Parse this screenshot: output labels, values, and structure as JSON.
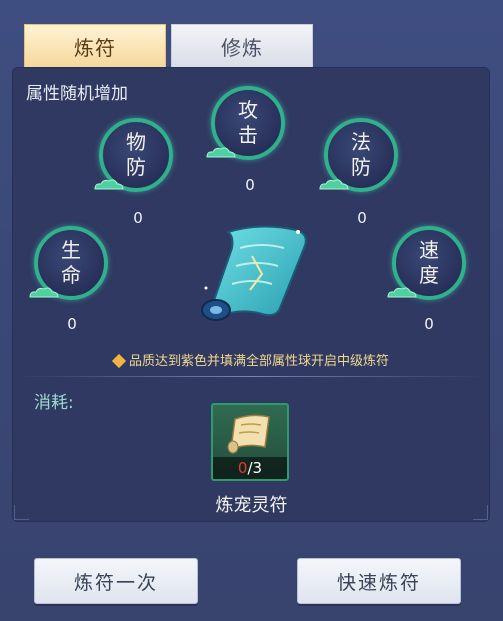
{
  "tabs": [
    {
      "label": "炼符",
      "active": true
    },
    {
      "label": "修炼",
      "active": false
    }
  ],
  "panel_title": "属性随机增加",
  "attributes": {
    "attack": {
      "label_1": "攻",
      "label_2": "击",
      "value": "0"
    },
    "phys_def": {
      "label_1": "物",
      "label_2": "防",
      "value": "0"
    },
    "magic_def": {
      "label_1": "法",
      "label_2": "防",
      "value": "0"
    },
    "hp": {
      "label_1": "生",
      "label_2": "命",
      "value": "0"
    },
    "speed": {
      "label_1": "速",
      "label_2": "度",
      "value": "0"
    }
  },
  "hint": "品质达到紫色并填满全部属性球开启中级炼符",
  "consume_label": "消耗:",
  "item": {
    "have": "0",
    "need": "/3",
    "name": "炼宠灵符"
  },
  "buttons": {
    "refine_once": "炼符一次",
    "quick_refine": "快速炼符"
  },
  "colors": {
    "orb_ring": "#2fb28c",
    "hint": "#f3d78e",
    "tab_active": "#f6d79c",
    "count_have": "#e23a2f"
  }
}
